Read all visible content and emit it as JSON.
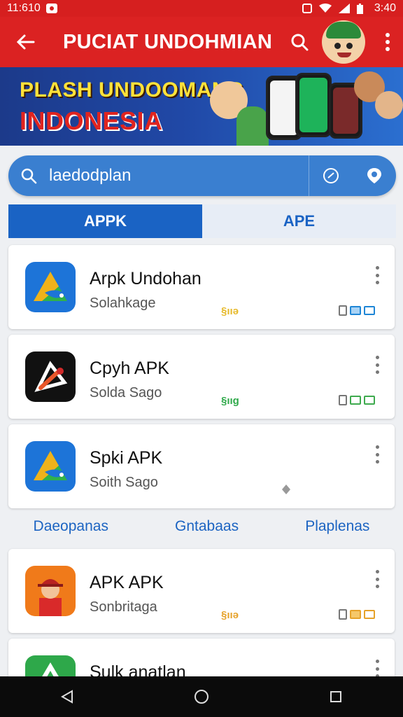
{
  "status_bar": {
    "time": "11:610",
    "right_time": "3:40"
  },
  "app_bar": {
    "title": "PUCIAT UNDOHMIAN",
    "back_icon": "arrow-left-icon",
    "search_icon": "search-icon",
    "menu_icon": "more-vert-icon",
    "color": "#db2222"
  },
  "banner": {
    "line1": "PLASH UNDOOMANG",
    "line2": "INDONESIA"
  },
  "search": {
    "value": "laedodplan",
    "left_icon": "search-icon",
    "right_icon_1": "chat-icon",
    "right_icon_2": "mic-icon"
  },
  "tabs": [
    {
      "label": "APPK",
      "active": true
    },
    {
      "label": "APE",
      "active": false
    }
  ],
  "apps": [
    {
      "name": "Arpk Undohan",
      "sub": "Solahkage",
      "meta": "§ııə",
      "meta_color": "#e6b92a",
      "flag_color": "#1f86d6"
    },
    {
      "name": "Cpyh APK",
      "sub": "Solda Sago",
      "meta": "§ııg",
      "meta_color": "#2fa94a",
      "flag_color": "#3eaa4e"
    },
    {
      "name": "Spki APK",
      "sub": "Soith Sago",
      "meta": "",
      "meta_color": "#999999",
      "flag_color": ""
    },
    {
      "name": "APK APK",
      "sub": "Sonbritaga",
      "meta": "§ııə",
      "meta_color": "#e6a22a",
      "flag_color": "#e6a22a"
    },
    {
      "name": "Sulk anatlan",
      "sub": "",
      "meta": "",
      "meta_color": "",
      "flag_color": ""
    }
  ],
  "categories": [
    "Daeopanas",
    "Gntabaas",
    "Plaplenas"
  ],
  "nav": {
    "back": "nav-back-icon",
    "home": "nav-home-icon",
    "recents": "nav-recents-icon"
  }
}
